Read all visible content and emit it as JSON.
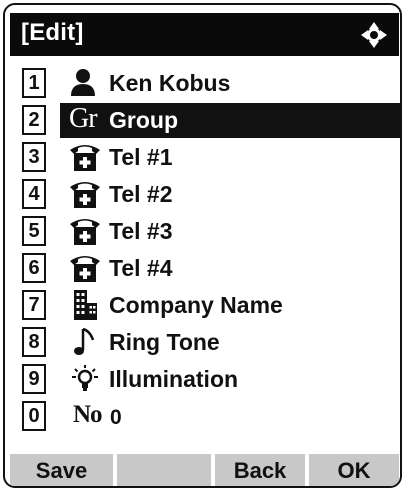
{
  "header": {
    "title": "[Edit]",
    "nav_icon": "four-way-navigation-icon"
  },
  "items": [
    {
      "key": "1",
      "label": "Ken Kobus",
      "icon": "person-icon"
    },
    {
      "key": "2",
      "label": "Group",
      "icon_text": "Gr",
      "icon": "group-icon",
      "selected": true
    },
    {
      "key": "3",
      "label": "Tel #1",
      "icon": "telephone-icon"
    },
    {
      "key": "4",
      "label": "Tel #2",
      "icon": "telephone-icon"
    },
    {
      "key": "5",
      "label": "Tel #3",
      "icon": "telephone-icon"
    },
    {
      "key": "6",
      "label": "Tel #4",
      "icon": "telephone-icon"
    },
    {
      "key": "7",
      "label": "Company Name",
      "icon": "building-icon"
    },
    {
      "key": "8",
      "label": "Ring Tone",
      "icon": "music-note-icon"
    },
    {
      "key": "9",
      "label": "Illumination",
      "icon": "light-bulb-icon"
    },
    {
      "key": "0",
      "label": "0",
      "icon_text": "No",
      "icon": "number-icon"
    }
  ],
  "softkeys": {
    "save": "Save",
    "blank": "",
    "back": "Back",
    "ok": "OK"
  },
  "colors": {
    "titlebar": "#0a0a0a",
    "selection": "#111111",
    "softkey_bar": "#c8c8c8"
  }
}
